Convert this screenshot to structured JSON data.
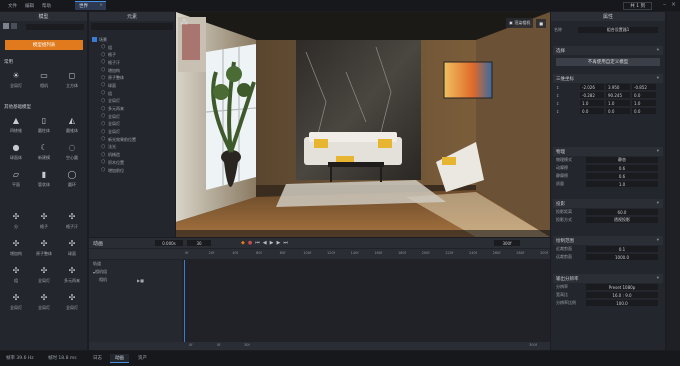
{
  "menu": [
    "文件",
    "编辑",
    "帮助"
  ],
  "world_tab": "世界",
  "topright_btn": "共 1 到",
  "left": {
    "title": "模型",
    "create_label": "模型组列表",
    "cat_basic": "常用",
    "basic": [
      {
        "label": "全局灯",
        "icon": "bulb-icon"
      },
      {
        "label": "相机",
        "icon": "camera-icon"
      },
      {
        "label": "立方体",
        "icon": "cube-icon"
      }
    ],
    "cat_geo": "其他基础模型",
    "geo": [
      {
        "label": "四棱锥",
        "icon": "pyramid-icon"
      },
      {
        "label": "圆柱体",
        "icon": "cylinder-icon"
      },
      {
        "label": "圆锥体",
        "icon": "cone-icon"
      },
      {
        "label": "球面体",
        "icon": "sphere-icon"
      },
      {
        "label": "新建模",
        "icon": "moon-icon"
      },
      {
        "label": "空心圆",
        "icon": "ring-icon"
      },
      {
        "label": "平面",
        "icon": "plane-icon"
      },
      {
        "label": "管状体",
        "icon": "pipe-icon"
      },
      {
        "label": "圆环",
        "icon": "torus-icon"
      }
    ],
    "mol": [
      {
        "label": "分",
        "icon": "molecule-icon"
      },
      {
        "label": "格子",
        "icon": "molecule-icon"
      },
      {
        "label": "格子汗",
        "icon": "molecule-icon"
      },
      {
        "label": "增加构",
        "icon": "molecule-icon"
      },
      {
        "label": "原子整体",
        "icon": "molecule-icon"
      },
      {
        "label": "球面",
        "icon": "molecule-icon"
      },
      {
        "label": "组",
        "icon": "molecule-icon"
      },
      {
        "label": "全局灯",
        "icon": "molecule-icon"
      },
      {
        "label": "多元再来",
        "icon": "molecule-icon"
      },
      {
        "label": "全局灯",
        "icon": "molecule-icon"
      },
      {
        "label": "全局灯",
        "icon": "molecule-icon"
      },
      {
        "label": "全局灯",
        "icon": "molecule-icon"
      }
    ]
  },
  "outliner": {
    "title": "元素",
    "root": "场景",
    "items": [
      "组",
      "格子",
      "格子汗",
      "增加构",
      "原子整体",
      "球面",
      "组",
      "全局灯",
      "多元再来",
      "全局灯",
      "全局灯",
      "全局灯",
      "新光效果前位置",
      "法光",
      "机械造",
      "积木位置",
      "增加前位"
    ]
  },
  "viewport": {
    "camera_btn": "渲染相机",
    "stop_icon": "stop-icon"
  },
  "props": {
    "title": "属性",
    "name_label": "名称",
    "name_value": "组合设置器1",
    "sec_select": "选择",
    "select_btn": "不再使用自定义模型",
    "sec_transform": "三维坐标",
    "pos": [
      "-2.026",
      "3.950",
      "-0.852"
    ],
    "rot": [
      "-0.282",
      "90.245",
      "0.0"
    ],
    "scale": [
      "1.0",
      "1.0",
      "1.0"
    ],
    "pivot": [
      "0.0",
      "0.0",
      "0.0"
    ],
    "sec_physics": "物理",
    "phys": [
      {
        "label": "物理模式",
        "value": "静态"
      },
      {
        "label": "动摩擦",
        "value": "0.6"
      },
      {
        "label": "静摩擦",
        "value": "0.6"
      },
      {
        "label": "质量",
        "value": "1.0"
      }
    ],
    "sec_cam": "投影",
    "cam": [
      {
        "label": "投影距离",
        "value": "60.0"
      },
      {
        "label": "投影方式",
        "value": "透视投影"
      }
    ],
    "sec_clip": "绘制范围",
    "clip": [
      {
        "label": "近裁剪面",
        "value": "0.1"
      },
      {
        "label": "远裁剪面",
        "value": "1000.0"
      }
    ],
    "sec_res": "输出分辨率",
    "res": [
      {
        "label": "分辨率",
        "value": "Preset 1080p"
      },
      {
        "label": "宽高比",
        "value": "16.0 : 9.0"
      },
      {
        "label": "分辨率比例",
        "value": "100.0"
      }
    ]
  },
  "timeline": {
    "tracks_label": "动画",
    "frame_value": "0.000s",
    "fps": "30",
    "end_value": "300f",
    "ruler": [
      "0f",
      "10f",
      "20f",
      "30f",
      "40f",
      "50f",
      "60f",
      "70f",
      "80f",
      "90f",
      "100f",
      "110f",
      "120f",
      "130f",
      "140f",
      "150f",
      "160f",
      "170f",
      "180f",
      "190f",
      "200f",
      "210f",
      "220f",
      "230f",
      "240f",
      "250f",
      "260f",
      "270f",
      "280f",
      "290f",
      "300f"
    ],
    "track_root": "轨道",
    "track_group": "相机组",
    "track_item": "相机",
    "foot": [
      "0f",
      "0f",
      "30f",
      "300f"
    ]
  },
  "status": {
    "fps": "帧率 39.6 Hz",
    "frame": "帧时 18.8 ms",
    "tabs": [
      "日志",
      "动画",
      "资产"
    ]
  },
  "colors": {
    "accent": "#e07a1c",
    "select": "#3a7bd5"
  }
}
